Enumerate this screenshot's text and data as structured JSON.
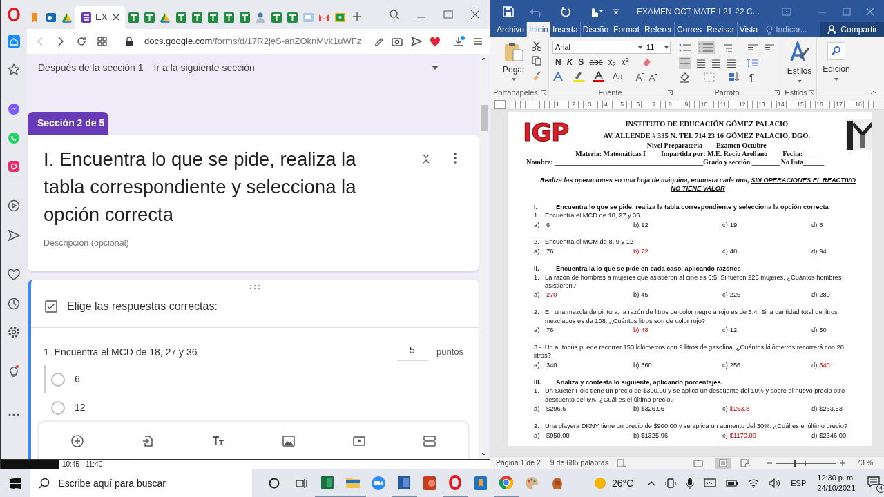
{
  "browser": {
    "tabs": [
      {
        "kind": "bookmark",
        "selected": false
      },
      {
        "kind": "mail",
        "selected": false
      },
      {
        "kind": "drive",
        "selected": false
      },
      {
        "kind": "forms",
        "selected": true,
        "label": "EX"
      },
      {
        "kind": "sheets",
        "selected": false
      },
      {
        "kind": "sheets",
        "selected": false
      },
      {
        "kind": "drive",
        "selected": false
      },
      {
        "kind": "sheets",
        "selected": false
      },
      {
        "kind": "sheets",
        "selected": false
      },
      {
        "kind": "sheets",
        "selected": false
      },
      {
        "kind": "sheets",
        "selected": false
      },
      {
        "kind": "sheets",
        "selected": false
      },
      {
        "kind": "person",
        "selected": false
      },
      {
        "kind": "sheets",
        "selected": false
      },
      {
        "kind": "sheets",
        "selected": false
      },
      {
        "kind": "slides",
        "selected": false
      },
      {
        "kind": "gmail",
        "selected": false
      },
      {
        "kind": "classroom",
        "selected": false
      }
    ],
    "url_host": "docs.google.com",
    "url_path": "/forms/d/17R2jeS-anZOknMvk1uWFz"
  },
  "form": {
    "after_section": "Después de la sección 1",
    "after_action": "Ir a la siguiente sección",
    "section_tab": "Sección 2 de 5",
    "title": "I. Encuentra lo que se pide, realiza la tabla correspondiente y selecciona la opción correcta",
    "description_placeholder": "Descripción (opcional)",
    "question": {
      "heading": "Elige las respuestas correctas:",
      "title": "1. Encuentra el MCD de 18, 27 y 36",
      "points": "5",
      "points_label": "puntos",
      "options": [
        {
          "label": "6",
          "selected": false
        },
        {
          "label": "12",
          "selected": false
        }
      ]
    }
  },
  "background_window": {
    "time_range": "10:45 - 11:40"
  },
  "word": {
    "title": "EXAMEN OCT MATE I 21-22 C...",
    "tabs": [
      {
        "label": "Archivo",
        "selected": false
      },
      {
        "label": "Inicio",
        "selected": true
      },
      {
        "label": "Inserta",
        "selected": false
      },
      {
        "label": "Diseño",
        "selected": false
      },
      {
        "label": "Format",
        "selected": false
      },
      {
        "label": "Referer",
        "selected": false
      },
      {
        "label": "Corres",
        "selected": false
      },
      {
        "label": "Revisar",
        "selected": false
      },
      {
        "label": "Vista",
        "selected": false
      }
    ],
    "tell_me": "Indicar...",
    "share": "Compartir",
    "font": "Arial",
    "font_size": "11",
    "paste": "Pegar",
    "styles": "Estilos",
    "editing": "Edición",
    "format_buttons": [
      "N",
      "K",
      "S",
      "abc",
      "x$_{2}$",
      "x$^{2}$"
    ],
    "case_button": "Aa",
    "pilcrow": "¶",
    "groups": [
      "Portapapeles",
      "Fuente",
      "Párrafo",
      "Estilos"
    ],
    "ruler": [
      "1",
      "2",
      "3",
      "4",
      "5",
      "6",
      "7",
      "8",
      "9",
      "10",
      "11",
      "12",
      "13",
      "14",
      "15",
      "16",
      "17",
      "18"
    ],
    "document": {
      "logo_text": "IGP",
      "header": [
        "INSTITUTO DE EDUCACIÓN GÓMEZ PALACIO",
        "AV. ALLENDE # 335 N.   TEL  714 23 16   GÓMEZ PALACIO, DGO.",
        "Nivel Preparatoria        Examen Octubre"
      ],
      "details": [
        "Materia: Matemáticas I",
        "Impartida por: M.E. Rocío Arellano",
        "Fecha: ____"
      ],
      "name_line": [
        "Nombre: ___________________________________________",
        "Grado y sección ________",
        "No lista______"
      ],
      "instruction": "Realiza las operaciones en una hoja de máquina, enumera cada una,",
      "instruction_emphasis": "SIN OPERACIONES EL REACTIVO NO TIENE VALOR",
      "sections": [
        {
          "numeral": "I.",
          "heading": "Encuentra lo que se pide, realiza la tabla correspondiente y selecciona la opción correcta",
          "questions": [
            {
              "kind": "hanging",
              "number": "1.",
              "text": "Encuentra el MCD de 18, 27 y 36",
              "options": [
                {
                  "letter": "a)",
                  "value": "6",
                  "letter_marked": false,
                  "value_marked": false
                },
                {
                  "letter": "b)",
                  "value": "12",
                  "letter_marked": false,
                  "value_marked": false
                },
                {
                  "letter": "c)",
                  "value": "19",
                  "letter_marked": false,
                  "value_marked": false
                },
                {
                  "letter": "d)",
                  "value": "8",
                  "letter_marked": false,
                  "value_marked": false
                }
              ]
            },
            {
              "kind": "hanging",
              "number": "2.",
              "text": "Encuentra el MCM de 8, 9 y 12",
              "options": [
                {
                  "letter": "a)",
                  "value": "76",
                  "letter_marked": false,
                  "value_marked": false
                },
                {
                  "letter": "b)",
                  "value": "72",
                  "letter_marked": true,
                  "value_marked": true
                },
                {
                  "letter": "c)",
                  "value": "48",
                  "letter_marked": false,
                  "value_marked": false
                },
                {
                  "letter": "d)",
                  "value": "94",
                  "letter_marked": false,
                  "value_marked": false
                }
              ]
            }
          ]
        },
        {
          "numeral": "II.",
          "heading": "Encuentra la lo que se pide en cada caso, aplicando razones",
          "questions": [
            {
              "kind": "hanging",
              "number": "1.",
              "text": "La razón de hombres a mujeres que asistieron al cine es 6:5. Si fueron 225 mujeres. ¿Cuántos hombres asistieron?",
              "options": [
                {
                  "letter": "a)",
                  "value": "270",
                  "letter_marked": false,
                  "value_marked": true
                },
                {
                  "letter": "b)",
                  "value": "45",
                  "letter_marked": false,
                  "value_marked": false
                },
                {
                  "letter": "c)",
                  "value": "225",
                  "letter_marked": false,
                  "value_marked": false
                },
                {
                  "letter": "d)",
                  "value": "280",
                  "letter_marked": false,
                  "value_marked": false
                }
              ]
            },
            {
              "kind": "hanging",
              "number": "2.",
              "text": "En una mezcla de pintura, la razón de litros de color negro a rojo es de 5:4. Si la cantidad total de litros mezclados es de 108, ¿Cuántos litros son de color rojo?",
              "options": [
                {
                  "letter": "a)",
                  "value": "76",
                  "letter_marked": false,
                  "value_marked": false
                },
                {
                  "letter": "b)",
                  "value": "48",
                  "letter_marked": true,
                  "value_marked": true
                },
                {
                  "letter": "c)",
                  "value": "12",
                  "letter_marked": false,
                  "value_marked": false
                },
                {
                  "letter": "d)",
                  "value": "50",
                  "letter_marked": false,
                  "value_marked": false
                }
              ]
            },
            {
              "kind": "inline",
              "number": "3.-",
              "text": "Un autobús puede recorrer 153 kilómetros con 9 litros de gasolina. ¿Cuántos kilómetros recorrerá con 20 litros?",
              "options": [
                {
                  "letter": "a)",
                  "value": "340",
                  "letter_marked": false,
                  "value_marked": false
                },
                {
                  "letter": "b)",
                  "value": "360",
                  "letter_marked": false,
                  "value_marked": false
                },
                {
                  "letter": "c)",
                  "value": "256",
                  "letter_marked": false,
                  "value_marked": false
                },
                {
                  "letter": "d)",
                  "value": "340",
                  "letter_marked": false,
                  "value_marked": true
                }
              ]
            }
          ]
        },
        {
          "numeral": "III.",
          "heading": "Analiza y contesta lo siguiente, aplicando porcentajes.",
          "questions": [
            {
              "kind": "hanging",
              "number": "1.",
              "text": "Un Sueter Polo tiene un precio de $300.00 y se aplica un descuento del 10% y sobre el nuevo precio otro descuento del 6%. ¿Cuál es el último precio?",
              "options": [
                {
                  "letter": "a)",
                  "value": "$296.6",
                  "letter_marked": false,
                  "value_marked": false
                },
                {
                  "letter": "b)",
                  "value": "$326.96",
                  "letter_marked": false,
                  "value_marked": false
                },
                {
                  "letter": "c)",
                  "value": "$253.8",
                  "letter_marked": false,
                  "value_marked": true
                },
                {
                  "letter": "d)",
                  "value": "$263.53",
                  "letter_marked": false,
                  "value_marked": false
                }
              ]
            },
            {
              "kind": "hanging",
              "number": "2.",
              "text": "Una playera DKNY tiene un precio de $900.00 y se aplica un aumento del 30%. ¿Cuál es el último precio?",
              "options": [
                {
                  "letter": "a)",
                  "value": "$950.00",
                  "letter_marked": false,
                  "value_marked": false
                },
                {
                  "letter": "b)",
                  "value": "$1325.96",
                  "letter_marked": false,
                  "value_marked": false
                },
                {
                  "letter": "c)",
                  "value": "$1170.00",
                  "letter_marked": false,
                  "value_marked": true
                },
                {
                  "letter": "d)",
                  "value": "$2346.00",
                  "letter_marked": false,
                  "value_marked": false
                }
              ]
            }
          ]
        }
      ]
    },
    "status": {
      "page": "Página 1 de 2",
      "words": "9 de 685 palabras",
      "zoom": "73 %",
      "zoom_level": {
        "level": 0.3
      }
    }
  },
  "taskbar": {
    "search_placeholder": "Escribe aquí para buscar",
    "temperature": "26°C",
    "language": "ESP",
    "time": "12:30 p. m.",
    "date": "24/10/2021",
    "notifications": "4"
  }
}
